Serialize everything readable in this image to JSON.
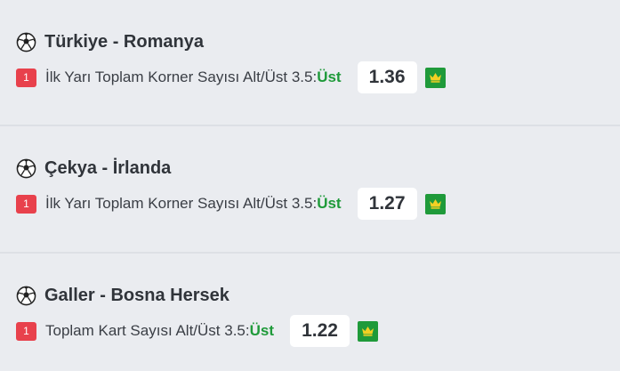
{
  "matches": [
    {
      "title": "Türkiye - Romanya",
      "badge": "1",
      "market": "İlk Yarı Toplam Korner Sayısı Alt/Üst 3.5:",
      "pick": "Üst",
      "odds": "1.36"
    },
    {
      "title": "Çekya - İrlanda",
      "badge": "1",
      "market": "İlk Yarı Toplam Korner Sayısı Alt/Üst 3.5:",
      "pick": "Üst",
      "odds": "1.27"
    },
    {
      "title": "Galler - Bosna Hersek",
      "badge": "1",
      "market": "Toplam Kart Sayısı Alt/Üst 3.5:",
      "pick": "Üst",
      "odds": "1.22"
    }
  ],
  "icons": {
    "sport": "soccer-ball-icon",
    "premium": "crown-icon"
  },
  "colors": {
    "background": "#eaecf0",
    "badge": "#e8414c",
    "pick": "#1f9a3a",
    "crown_bg": "#1f9a3a",
    "crown": "#f2d024"
  }
}
